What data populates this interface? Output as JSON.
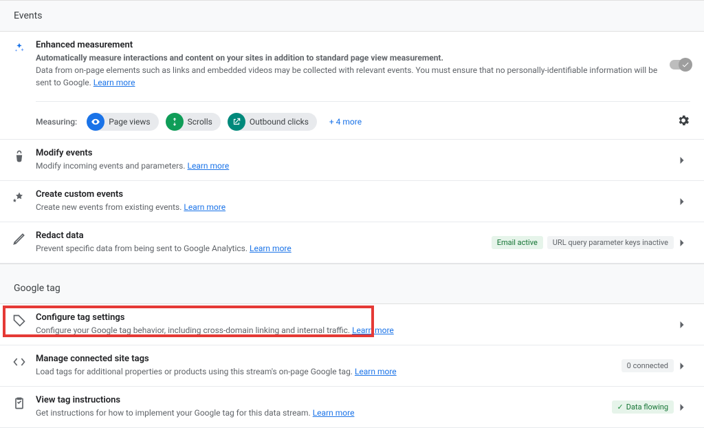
{
  "sections": {
    "events_heading": "Events",
    "google_tag_heading": "Google tag"
  },
  "enhanced_measurement": {
    "title": "Enhanced measurement",
    "desc_bold": "Automatically measure interactions and content on your sites in addition to standard page view measurement.",
    "desc_plain": "Data from on-page elements such as links and embedded videos may be collected with relevant events. You must ensure that no personally-identifiable information will be sent to Google. ",
    "learn_more": "Learn more",
    "measuring_label": "Measuring:",
    "chips": [
      {
        "label": "Page views",
        "color": "blue"
      },
      {
        "label": "Scrolls",
        "color": "green"
      },
      {
        "label": "Outbound clicks",
        "color": "teal"
      }
    ],
    "more": "+ 4 more"
  },
  "rows": {
    "modify": {
      "title": "Modify events",
      "sub": "Modify incoming events and parameters. ",
      "learn": "Learn more"
    },
    "custom": {
      "title": "Create custom events",
      "sub": "Create new events from existing events. ",
      "learn": "Learn more"
    },
    "redact": {
      "title": "Redact data",
      "sub": "Prevent specific data from being sent to Google Analytics. ",
      "learn": "Learn more",
      "badges": {
        "active": "Email active",
        "inactive": "URL query parameter keys inactive"
      }
    },
    "configure": {
      "title": "Configure tag settings",
      "sub": "Configure your Google tag behavior, including cross-domain linking and internal traffic. ",
      "learn": "Learn more"
    },
    "connected": {
      "title": "Manage connected site tags",
      "sub": "Load tags for additional properties or products using this stream's on-page Google tag. ",
      "learn": "Learn more",
      "count": "0 connected"
    },
    "instructions": {
      "title": "View tag instructions",
      "sub": "Get instructions for how to implement your Google tag for this data stream. ",
      "learn": "Learn more",
      "status": "Data flowing"
    }
  }
}
